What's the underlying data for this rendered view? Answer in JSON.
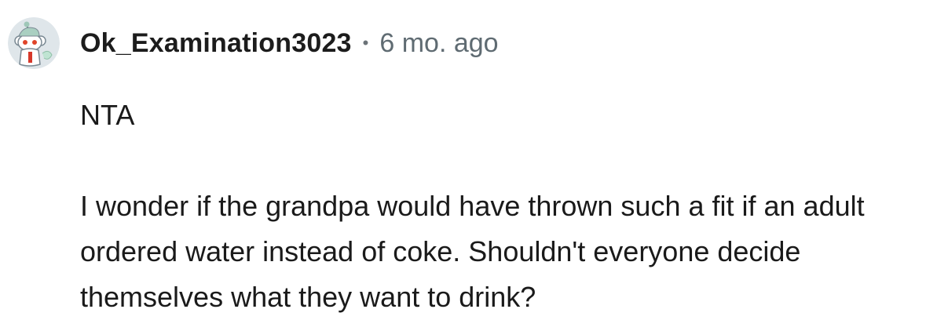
{
  "comment": {
    "author": {
      "username": "Ok_Examination3023",
      "avatar_icon": "reddit-snoo-avatar-icon"
    },
    "separator": "•",
    "timestamp": "6 mo. ago",
    "body": {
      "verdict": "NTA",
      "paragraph": "I wonder if the grandpa would have thrown such a fit if an adult ordered water instead of coke. Shouldn't everyone decide themselves what they want to drink?"
    }
  },
  "colors": {
    "username": "#1c1c1c",
    "timestamp": "#5f6b72",
    "body_text": "#1a1a1a",
    "background": "#ffffff"
  }
}
